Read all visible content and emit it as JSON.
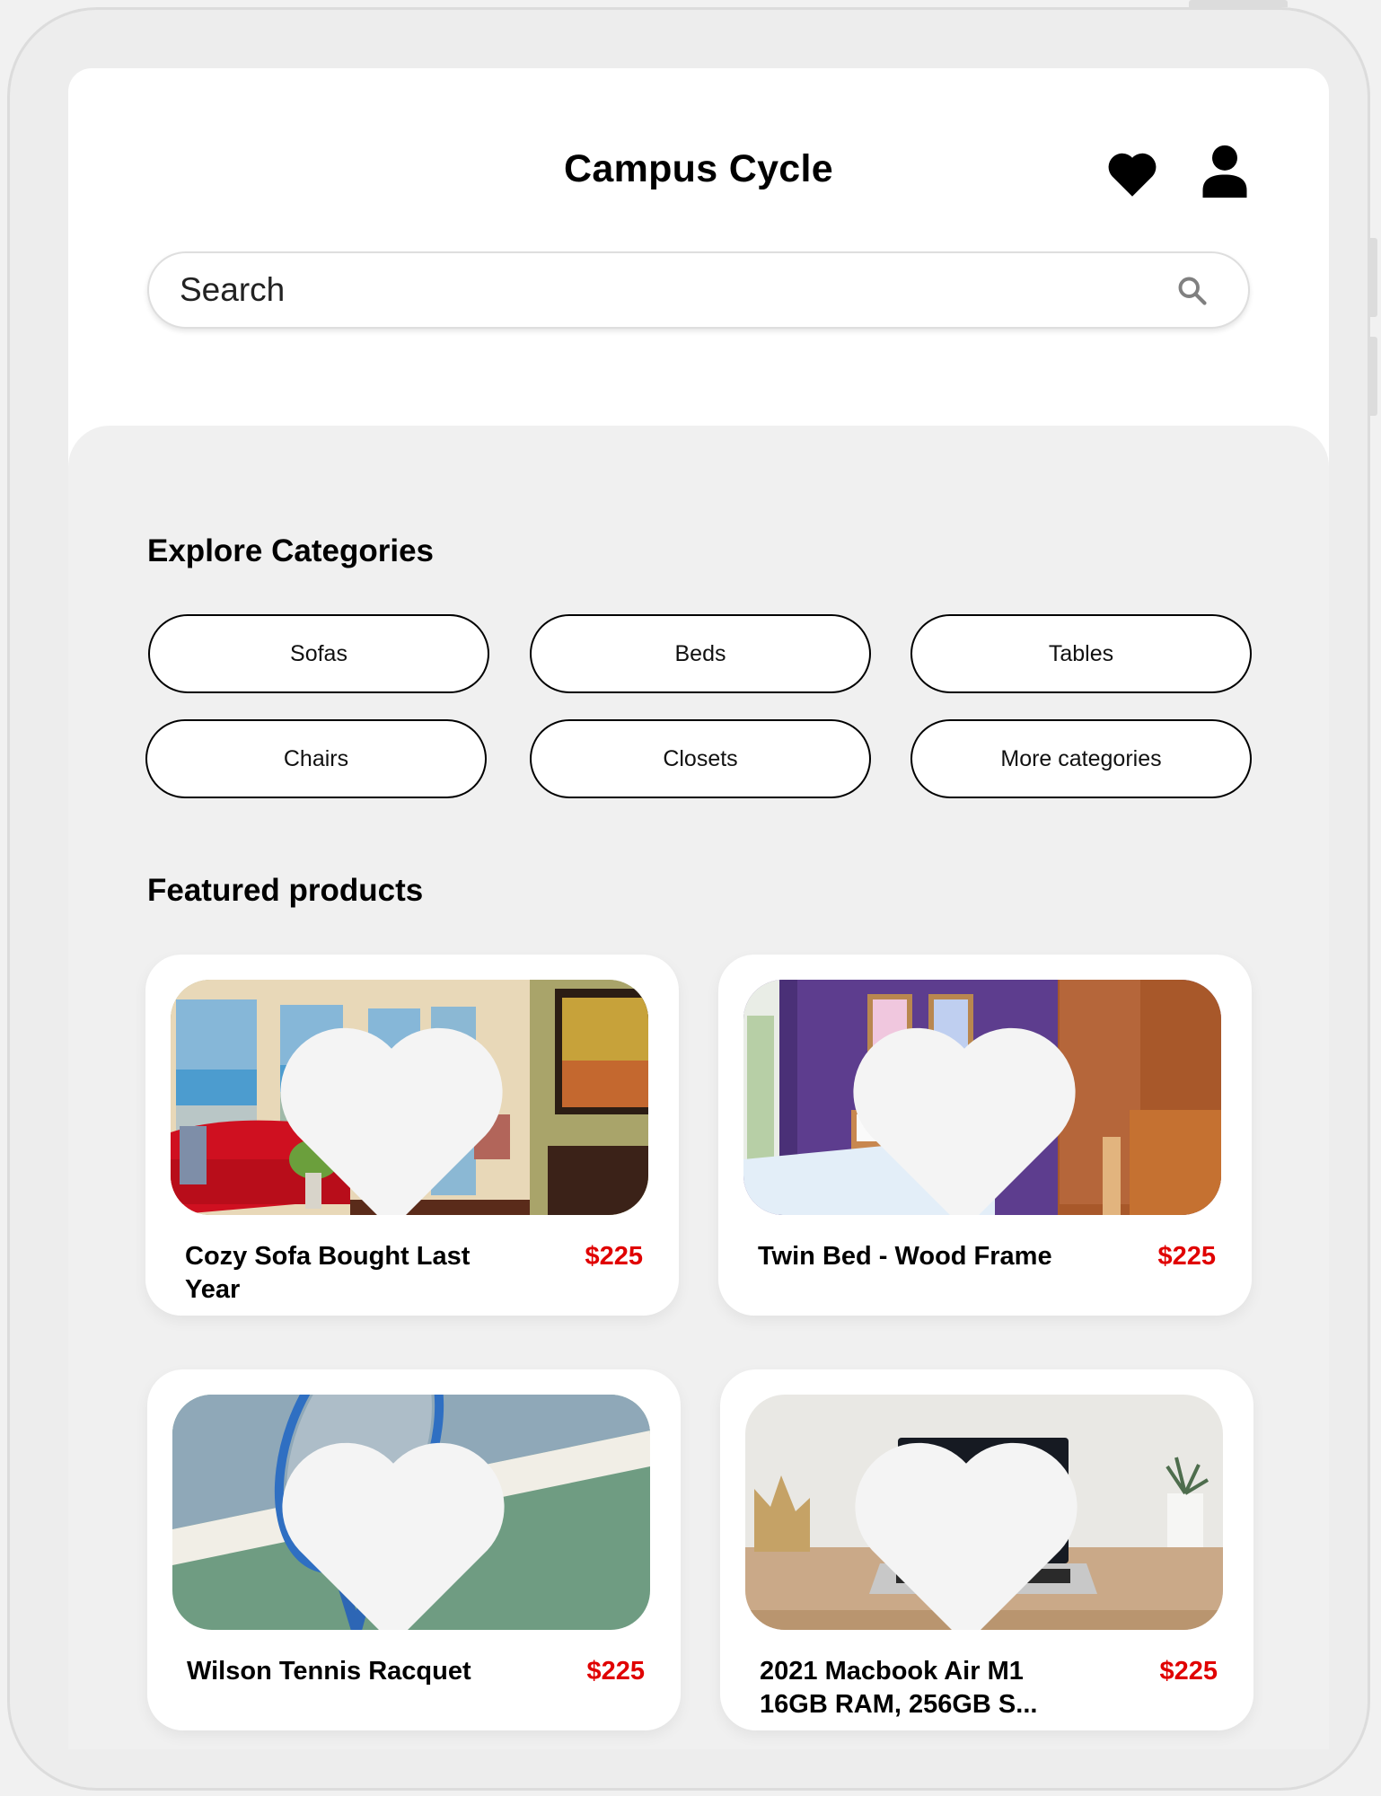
{
  "app": {
    "title": "Campus Cycle",
    "icons": {
      "favorites": "heart-icon",
      "profile": "user-icon",
      "search": "search-icon"
    }
  },
  "search": {
    "placeholder": "Search",
    "value": ""
  },
  "categories": {
    "title": "Explore Categories",
    "items": [
      {
        "label": "Sofas"
      },
      {
        "label": "Beds"
      },
      {
        "label": "Tables"
      },
      {
        "label": "Chairs"
      },
      {
        "label": "Closets"
      },
      {
        "label": "More categories"
      }
    ]
  },
  "featured": {
    "title": "Featured products",
    "products": [
      {
        "name": "Cozy Sofa Bought Last Year",
        "price": "$225",
        "image": "living room with red sofa",
        "favorited": false
      },
      {
        "name": "Twin Bed - Wood Frame",
        "price": "$225",
        "image": "bedroom with twin bed and purple wall",
        "favorited": false
      },
      {
        "name": "Wilson Tennis Racquet",
        "price": "$225",
        "image": "blue tennis racquet on court",
        "favorited": false
      },
      {
        "name": "2021 Macbook Air M1 16GB RAM, 256GB S...",
        "price": "$225",
        "image": "laptop on wooden desk",
        "favorited": false
      }
    ]
  },
  "colors": {
    "price": "#e00000",
    "background": "#f0f0f0",
    "card": "#ffffff",
    "text": "#000000"
  }
}
